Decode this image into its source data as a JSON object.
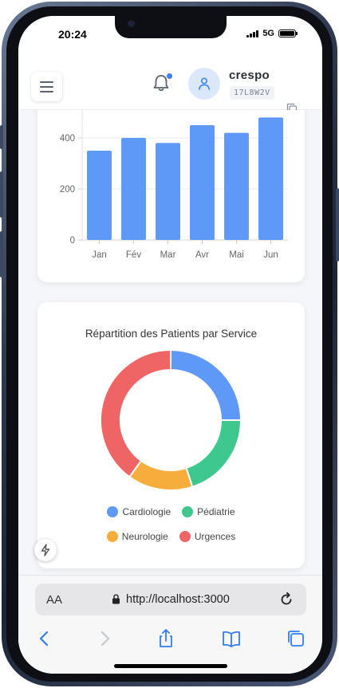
{
  "status": {
    "time": "20:24",
    "network": "5G"
  },
  "header": {
    "username": "crespo",
    "user_code": "17L8W2V"
  },
  "bar_chart": {
    "chart_data": {
      "type": "bar",
      "categories": [
        "Jan",
        "Fév",
        "Mar",
        "Avr",
        "Mai",
        "Jun"
      ],
      "values": [
        350,
        400,
        380,
        450,
        420,
        480
      ],
      "yticks": [
        0,
        200,
        400
      ],
      "ylim": [
        0,
        500
      ],
      "color": "#5e99f7"
    }
  },
  "donut_chart": {
    "title": "Répartition des Patients par Service",
    "chart_data": {
      "type": "pie",
      "categories": [
        "Cardiologie",
        "Pédiatrie",
        "Neurologie",
        "Urgences"
      ],
      "values": [
        25,
        20,
        15,
        40
      ],
      "colors": [
        "#5e99f7",
        "#3ec78f",
        "#f6ad3c",
        "#ef6565"
      ]
    }
  },
  "browser": {
    "aa_label": "AA",
    "url": "http://localhost:3000"
  }
}
